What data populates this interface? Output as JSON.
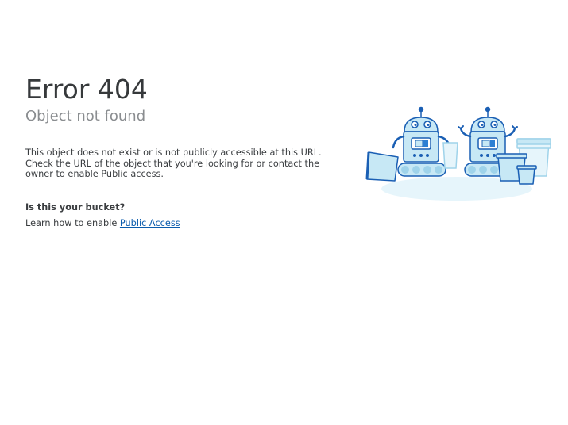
{
  "error": {
    "title": "Error 404",
    "subtitle": "Object not found"
  },
  "description": {
    "lines": [
      "This object does not exist or is not publicly accessible at this URL.",
      "Check the URL of the object that you're looking for or contact the",
      "owner to enable Public access."
    ]
  },
  "bucket": {
    "heading": "Is this your bucket?",
    "learn_prefix": "Learn how to enable ",
    "link_label": "Public Access"
  },
  "illustration": {
    "icon": "robots-icon",
    "colors": {
      "outline": "#1a5fb4",
      "fill": "#c7e8f5",
      "light": "#e6f5fb",
      "accent": "#2d7fd3"
    }
  }
}
